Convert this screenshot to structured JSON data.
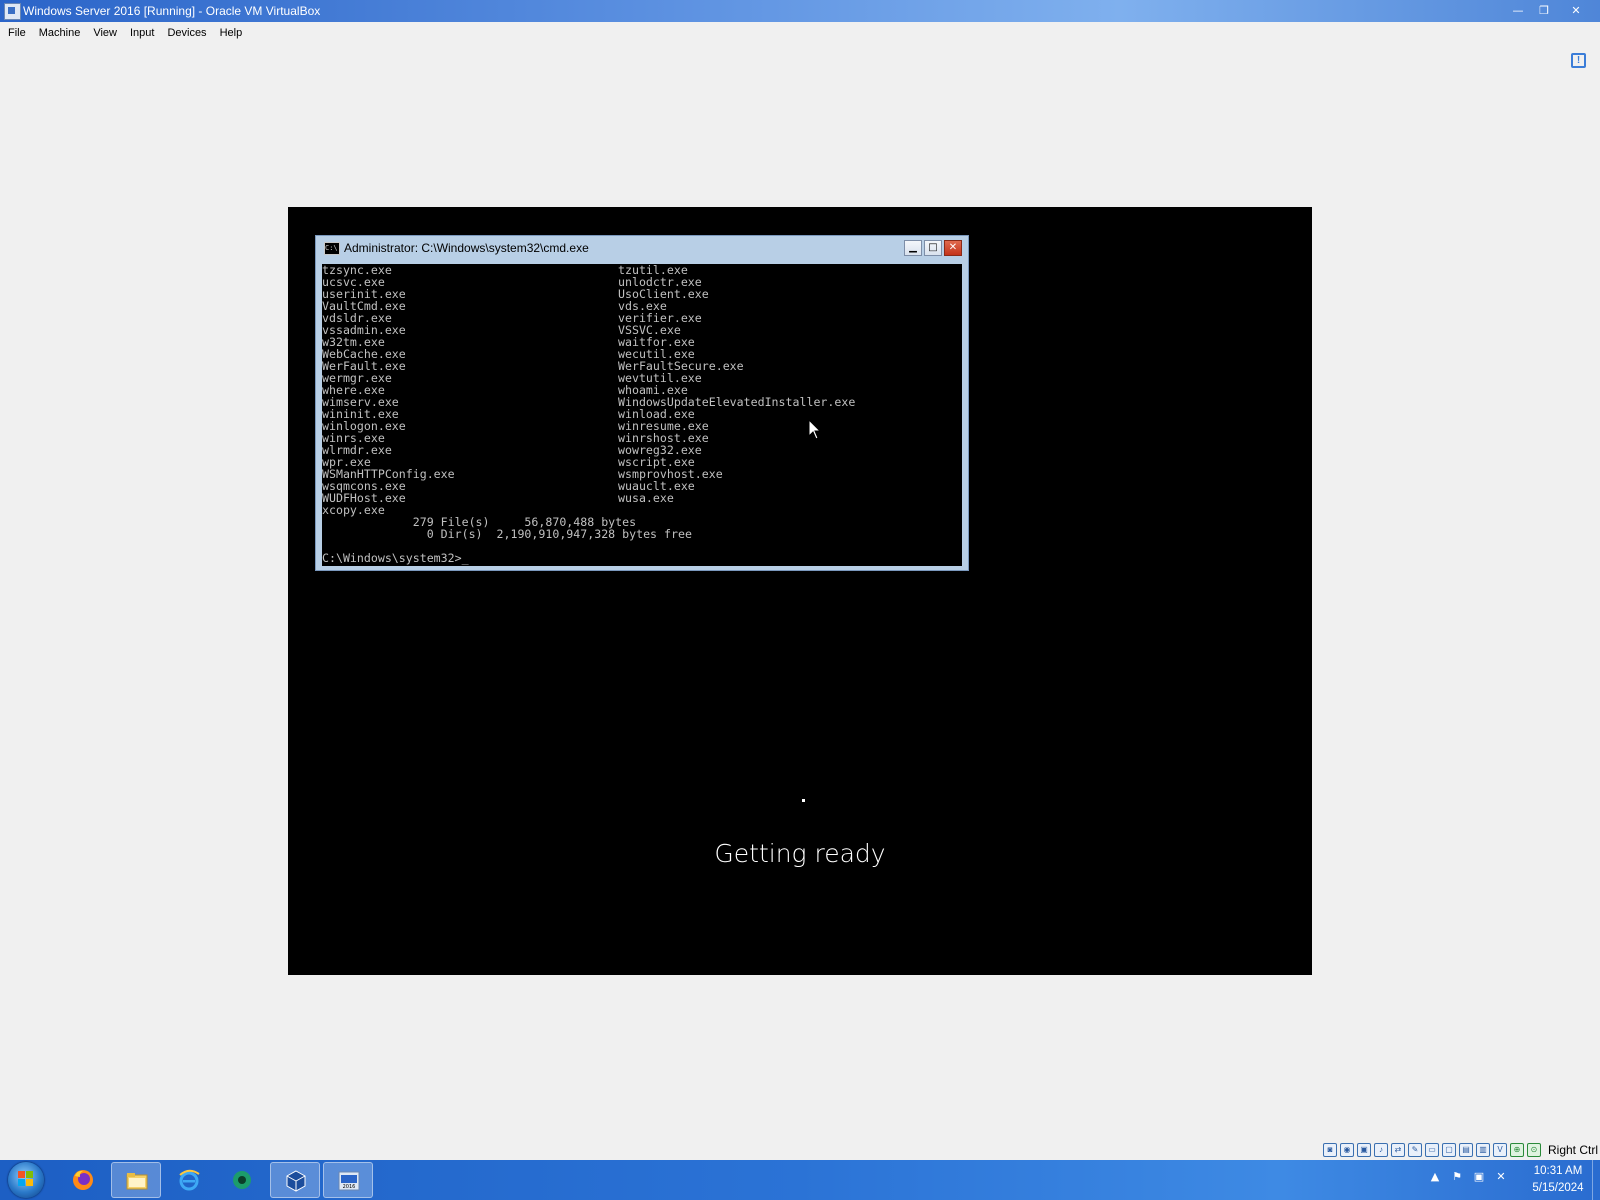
{
  "host_window": {
    "title": "Windows Server 2016 [Running] - Oracle VM VirtualBox",
    "controls": {
      "minimize": "—",
      "restore": "❐",
      "close": "✕"
    }
  },
  "menu": [
    "File",
    "Machine",
    "View",
    "Input",
    "Devices",
    "Help"
  ],
  "notification_icon": "!",
  "cmd": {
    "title": "Administrator: C:\\Windows\\system32\\cmd.exe",
    "icon_text": "C:\\",
    "buttons": {
      "minimize": "▁",
      "maximize": "□",
      "close": "✕"
    },
    "rows": [
      [
        "tzsync.exe",
        "tzutil.exe"
      ],
      [
        "ucsvc.exe",
        "unlodctr.exe"
      ],
      [
        "userinit.exe",
        "UsoClient.exe"
      ],
      [
        "VaultCmd.exe",
        "vds.exe"
      ],
      [
        "vdsldr.exe",
        "verifier.exe"
      ],
      [
        "vssadmin.exe",
        "VSSVC.exe"
      ],
      [
        "w32tm.exe",
        "waitfor.exe"
      ],
      [
        "WebCache.exe",
        "wecutil.exe"
      ],
      [
        "WerFault.exe",
        "WerFaultSecure.exe"
      ],
      [
        "wermgr.exe",
        "wevtutil.exe"
      ],
      [
        "where.exe",
        "whoami.exe"
      ],
      [
        "wimserv.exe",
        "WindowsUpdateElevatedInstaller.exe"
      ],
      [
        "wininit.exe",
        "winload.exe"
      ],
      [
        "winlogon.exe",
        "winresume.exe"
      ],
      [
        "winrs.exe",
        "winrshost.exe"
      ],
      [
        "wlrmdr.exe",
        "wowreg32.exe"
      ],
      [
        "wpr.exe",
        "wscript.exe"
      ],
      [
        "WSManHTTPConfig.exe",
        "wsmprovhost.exe"
      ],
      [
        "wsqmcons.exe",
        "wuauclt.exe"
      ],
      [
        "WUDFHost.exe",
        "wusa.exe"
      ],
      [
        "xcopy.exe",
        ""
      ]
    ],
    "summary_files": "             279 File(s)     56,870,488 bytes",
    "summary_dirs": "               0 Dir(s)  2,190,910,947,328 bytes free",
    "prompt": "C:\\Windows\\system32>_"
  },
  "guest_status": {
    "text": "Getting ready"
  },
  "statusbar": {
    "icons": [
      "hdd-icon",
      "optical-icon",
      "floppy-icon",
      "audio-icon",
      "network-icon",
      "usb-icon",
      "shared-folder-icon",
      "display-icon",
      "screen-icon",
      "recording-icon",
      "vt-x-icon",
      "mouse-integration-icon",
      "capture-icon"
    ],
    "icon_glyphs": [
      "◙",
      "◉",
      "▣",
      "♪",
      "⇄",
      "✎",
      "▭",
      "▢",
      "▤",
      "▥",
      "V",
      "⊕",
      "⊙"
    ],
    "host_key": "Right Ctrl"
  },
  "taskbar": {
    "apps": [
      "firefox-icon",
      "file-explorer-icon",
      "internet-explorer-icon",
      "app-icon",
      "virtualbox-icon",
      "vm-window-icon"
    ],
    "vm_badge": "2016",
    "tray_glyphs": {
      "show_hidden": "▲",
      "action_center": "⚑",
      "network": "▣",
      "volume": "✕"
    },
    "clock_time": "10:31 AM",
    "clock_date": "5/15/2024"
  },
  "colors": {
    "console_bg": "#000000",
    "console_text": "#c0c0c0",
    "taskbar": "#2b73d6",
    "title_bar": "#2a64c8"
  }
}
